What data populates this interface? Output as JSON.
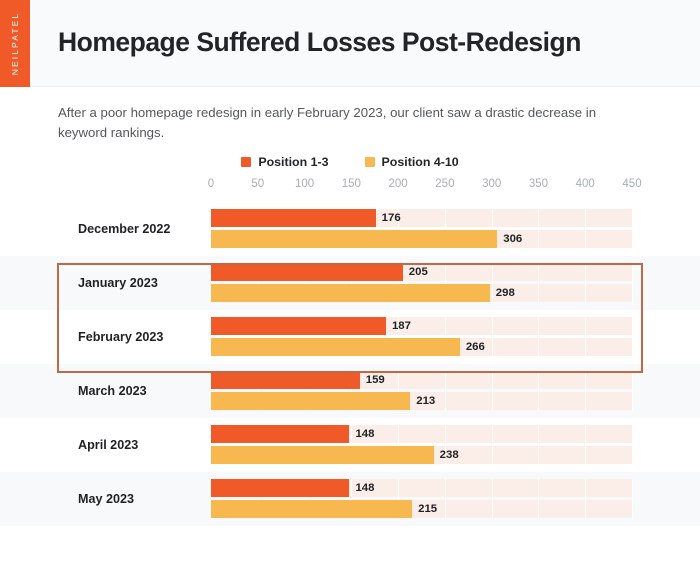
{
  "brand": {
    "label": "NEILPATEL",
    "color": "#EF5A28"
  },
  "header": {
    "title": "Homepage Suffered Losses Post-Redesign"
  },
  "subtitle": "After a poor homepage redesign in early February 2023, our client saw a drastic decrease in keyword rankings.",
  "legend": [
    {
      "label": "Position 1-3",
      "color": "#EF5A28",
      "icon": "square-swatch-icon"
    },
    {
      "label": "Position 4-10",
      "color": "#F7B94F",
      "icon": "square-swatch-icon"
    }
  ],
  "highlight": {
    "rows": [
      "January 2023",
      "February 2023"
    ],
    "border_color": "#BF6A47"
  },
  "chart_data": {
    "type": "bar",
    "orientation": "horizontal",
    "title": "Homepage Suffered Losses Post-Redesign",
    "xlabel": "",
    "ylabel": "",
    "xlim": [
      0,
      450
    ],
    "xticks": [
      0,
      50,
      100,
      150,
      200,
      250,
      300,
      350,
      400,
      450
    ],
    "grid": true,
    "legend_position": "top-center",
    "categories": [
      "December 2022",
      "January 2023",
      "February 2023",
      "March 2023",
      "April 2023",
      "May 2023"
    ],
    "series": [
      {
        "name": "Position 1-3",
        "color": "#EF5A28",
        "values": [
          176,
          205,
          187,
          159,
          148,
          148
        ]
      },
      {
        "name": "Position 4-10",
        "color": "#F7B94F",
        "values": [
          306,
          298,
          266,
          213,
          238,
          215
        ]
      }
    ],
    "track_color": "#FBEEE9",
    "annotations": [
      "Highlighted period: January 2023 and February 2023"
    ]
  }
}
